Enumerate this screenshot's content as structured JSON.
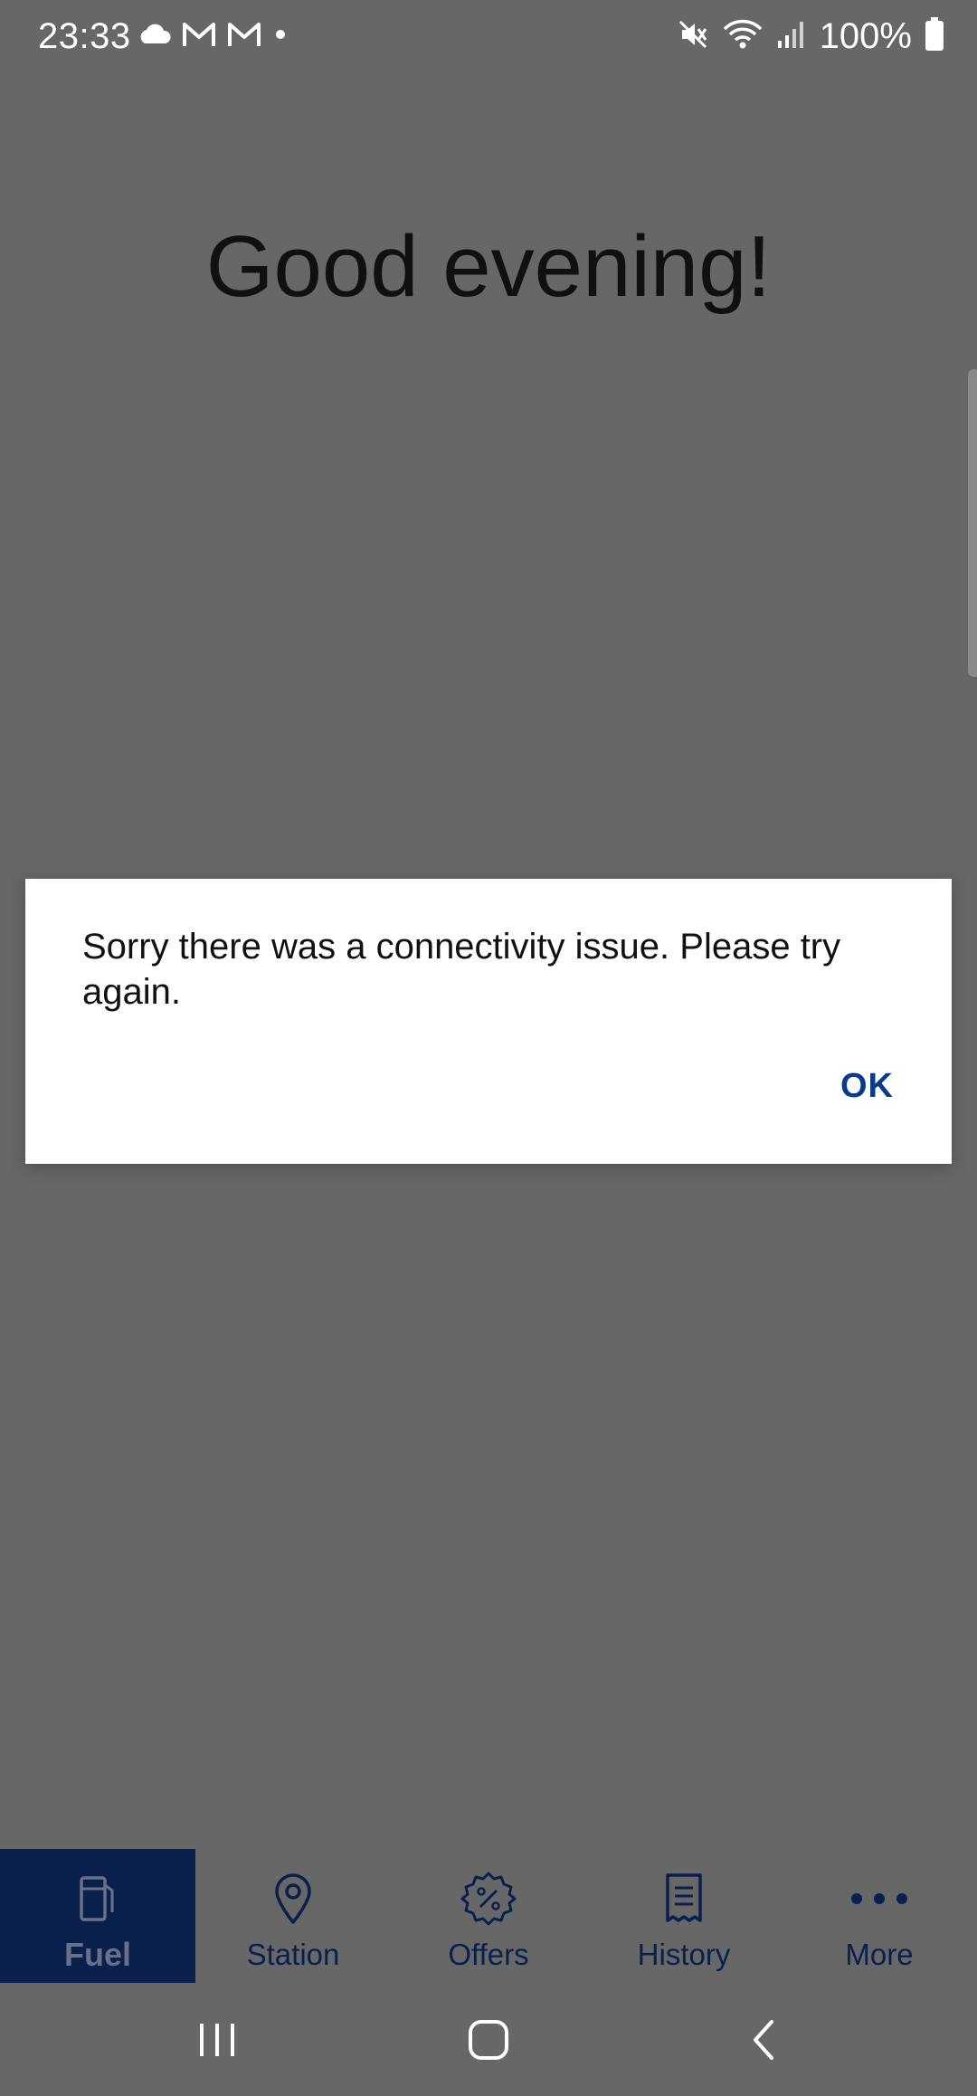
{
  "status_bar": {
    "time": "23:33",
    "battery": "100%"
  },
  "main": {
    "greeting": "Good evening!"
  },
  "dialog": {
    "message": "Sorry there was a connectivity issue. Please try again.",
    "ok_label": "OK"
  },
  "bottom_nav": {
    "items": [
      {
        "label": "Fuel",
        "icon": "fuel-pump-icon",
        "active": true
      },
      {
        "label": "Station",
        "icon": "location-pin-icon",
        "active": false
      },
      {
        "label": "Offers",
        "icon": "percent-badge-icon",
        "active": false
      },
      {
        "label": "History",
        "icon": "receipt-icon",
        "active": false
      },
      {
        "label": "More",
        "icon": "more-dots-icon",
        "active": false
      }
    ]
  },
  "colors": {
    "overlay_bg": "#676767",
    "brand_navy": "#0b1f4d",
    "link_blue": "#0b3a8c"
  }
}
